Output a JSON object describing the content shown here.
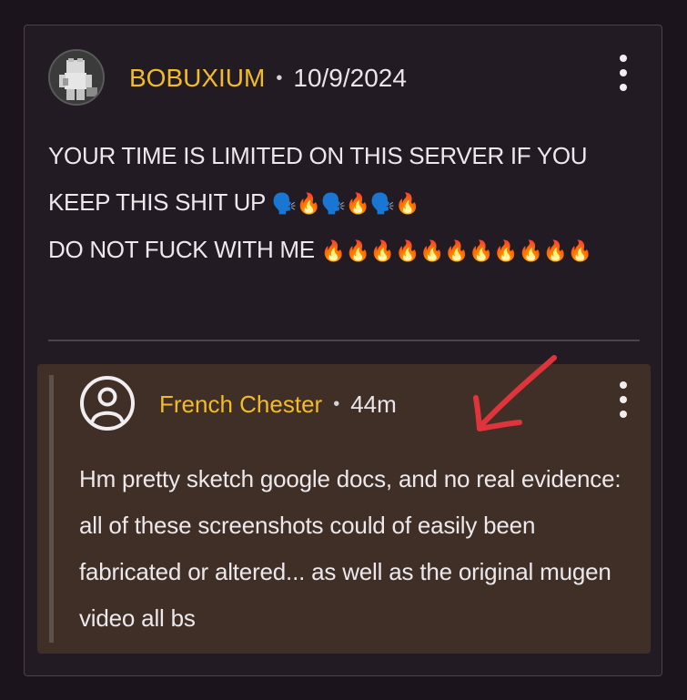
{
  "post": {
    "author": "BOBUXIUM",
    "separator": "•",
    "date": "10/9/2024",
    "lines": [
      "YOUR TIME IS LIMITED ON THIS SERVER IF YOU KEEP THIS SHIT UP",
      "DO NOT FUCK WITH ME"
    ],
    "line1_emojis": "🗣️🔥🗣️🔥🗣️🔥",
    "line2_emojis": "🔥🔥🔥🔥🔥🔥🔥🔥🔥🔥🔥"
  },
  "reply": {
    "author": "French Chester",
    "separator": "•",
    "time": "44m",
    "body": "Hm pretty sketch google docs, and no real evidence: all of these screenshots could of easily been fabricated or altered... as well as the original mugen video all bs"
  },
  "icons": {
    "post_avatar": "blocky-character-avatar-icon",
    "reply_avatar": "user-circle-icon",
    "menu": "kebab-menu-icon",
    "annotation": "red-arrow-icon"
  },
  "colors": {
    "background": "#1b141c",
    "card": "#231b23",
    "reply_card": "#3f2f26",
    "author": "#f2bb2a",
    "text": "#ece8ec",
    "arrow": "#e0343c"
  }
}
